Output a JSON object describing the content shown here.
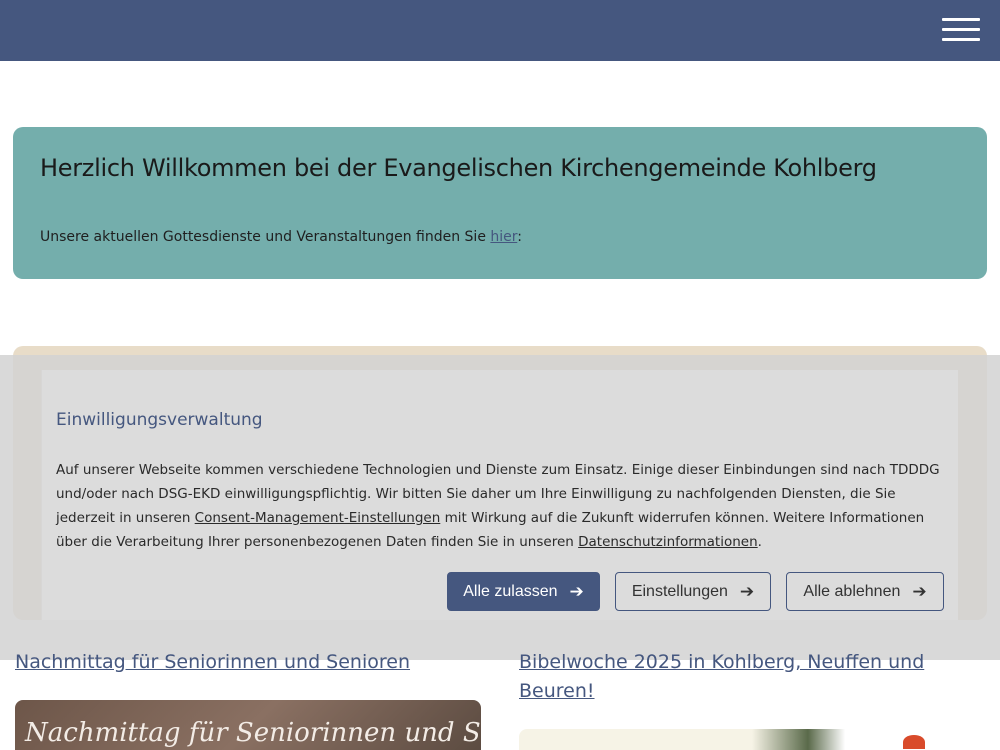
{
  "header": {
    "menu_icon": "hamburger-menu-icon",
    "background_color": "#45577f"
  },
  "welcome": {
    "title": "Herzlich Willkommen bei der Evangelischen Kirchengemeinde Kohlberg",
    "text_before": "Unsere aktuellen Gottesdienste und Veranstaltungen finden Sie ",
    "link": "hier",
    "text_after": ":",
    "background_color": "#74aeac"
  },
  "consent": {
    "title": "Einwilligungsverwaltung",
    "text_1": "Auf unserer Webseite kommen verschiedene Technologien und Dienste zum Einsatz. Einige dieser Einbindungen sind nach TDDDG und/oder nach DSG-EKD einwilligungspflichtig. Wir bitten Sie daher um Ihre Einwilligung zu nachfolgenden Diensten, die Sie jederzeit in unseren ",
    "link_consent": "Consent-Management-Einstellungen",
    "text_2": " mit Wirkung auf die Zukunft widerrufen können. Weitere Informationen über die Verarbeitung Ihrer personenbezogenen Daten finden Sie in unseren ",
    "link_privacy": "Datenschutzinformationen",
    "text_3": ".",
    "buttons": {
      "accept_all": "Alle zulassen",
      "settings": "Einstellungen",
      "reject_all": "Alle ablehnen"
    },
    "arrow_icon": "arrow-right-icon"
  },
  "posts": [
    {
      "title": "Nachmittag für Seniorinnen und Senioren",
      "image_text": "Nachmittag für Seniorinnen und Senioren"
    },
    {
      "title": "Bibelwoche 2025 in Kohlberg, Neuffen und Beuren!"
    }
  ]
}
